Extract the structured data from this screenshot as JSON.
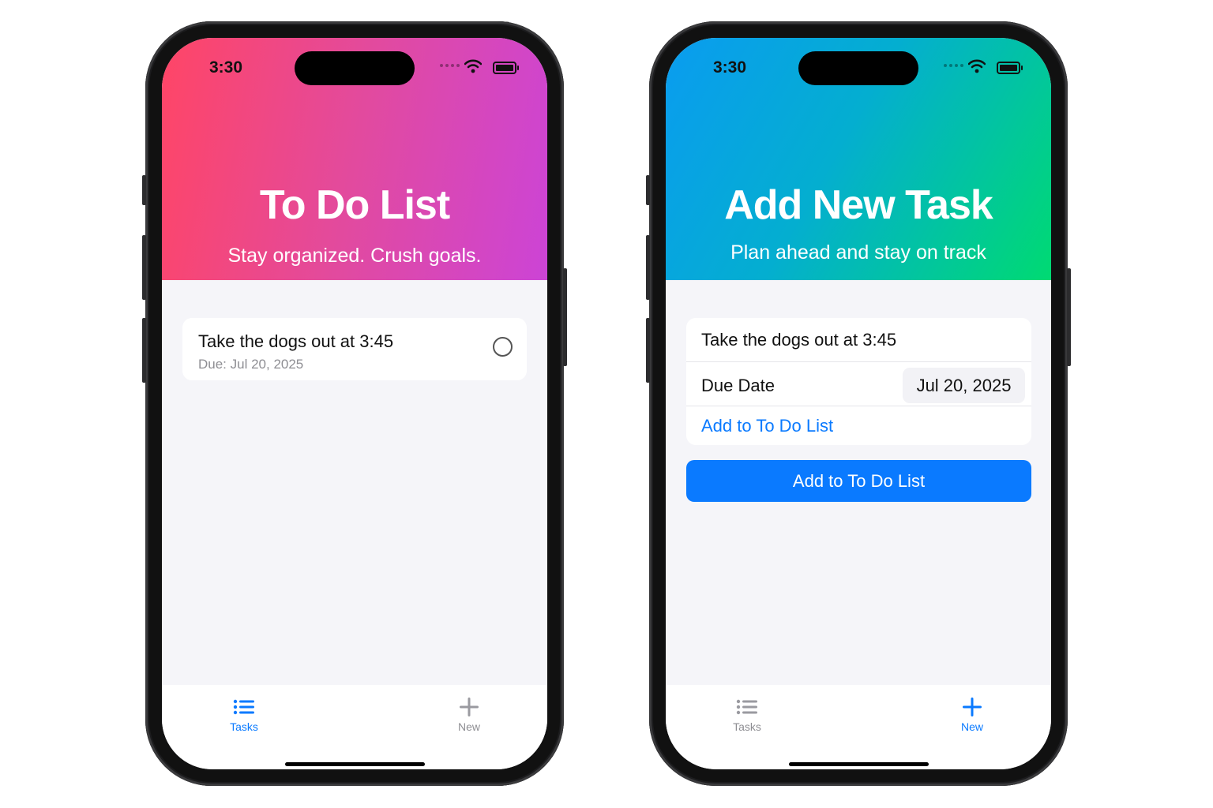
{
  "status": {
    "time": "3:30"
  },
  "list_screen": {
    "title": "To Do List",
    "subtitle": "Stay organized. Crush goals.",
    "task": {
      "title": "Take the dogs out at 3:45",
      "due": "Due: Jul 20, 2025",
      "completed": false
    }
  },
  "new_screen": {
    "title": "Add New Task",
    "subtitle": "Plan ahead and stay on track",
    "task_name": "Take the dogs out at 3:45",
    "due_date_label": "Due Date",
    "due_date_value": "Jul 20, 2025",
    "add_link_label": "Add to To Do List",
    "add_button_label": "Add to To Do List"
  },
  "tabbar": {
    "tasks_label": "Tasks",
    "new_label": "New",
    "tasks_icon": "list-icon",
    "new_icon": "plus-icon"
  },
  "colors": {
    "accent": "#0a7aff",
    "list_header_gradient": [
      "#ff4566",
      "#cc44d6"
    ],
    "new_header_gradient": [
      "#0a9cf0",
      "#00da72"
    ],
    "inactive": "#8e8e93"
  }
}
